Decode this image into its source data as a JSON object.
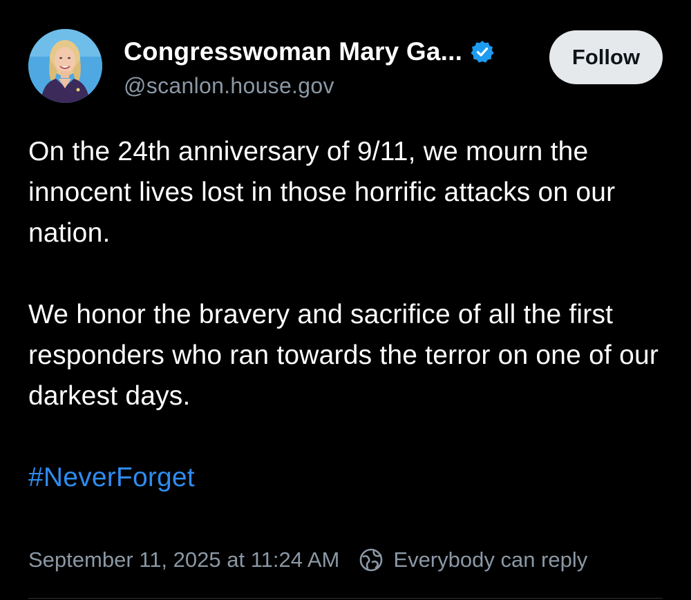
{
  "author": {
    "display_name": "Congresswoman Mary Ga...",
    "handle": "@scanlon.house.gov",
    "verified": true,
    "verified_color": "#1d9bf0",
    "avatar_icon": "profile-photo"
  },
  "follow_button": {
    "label": "Follow"
  },
  "post": {
    "paragraph_1": "On the 24th anniversary of 9/11, we mourn the innocent lives lost in those horrific attacks on our nation.",
    "paragraph_2": "We honor the bravery and sacrifice of all the first responders who ran towards the terror on one of our darkest days.",
    "hashtag": "#NeverForget",
    "hashtag_color": "#2f8cf0"
  },
  "meta": {
    "timestamp": "September 11, 2025 at 11:24 AM",
    "reply_setting": "Everybody can reply",
    "reply_icon": "globe-icon"
  },
  "colors": {
    "background": "#000000",
    "text": "#ffffff",
    "secondary_text": "#8b98a5",
    "button_bg": "#e6e9ec"
  }
}
